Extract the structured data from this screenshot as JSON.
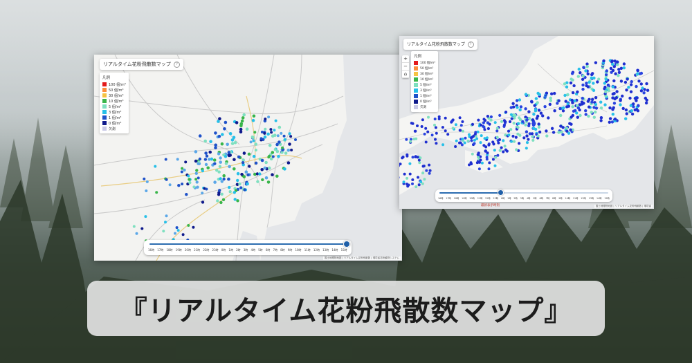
{
  "headline": "『リアルタイム花粉飛散数マップ』",
  "left_shot": {
    "title": "リアルタイム花粉飛散数マップ",
    "help_icon": "?",
    "legend": {
      "header": "凡例",
      "items": [
        {
          "label": "100 個/m³",
          "color": "#e31a1c"
        },
        {
          "label": "50 個/m³",
          "color": "#fd8d3c"
        },
        {
          "label": "30 個/m³",
          "color": "#f6c343"
        },
        {
          "label": "10 個/m³",
          "color": "#39b54a"
        },
        {
          "label": "5 個/m³",
          "color": "#7fe0c0"
        },
        {
          "label": "3 個/m³",
          "color": "#27c0e8"
        },
        {
          "label": "1 個/m³",
          "color": "#1f52c9"
        },
        {
          "label": "0 個/m³",
          "color": "#0f1a8c"
        },
        {
          "label": "欠測",
          "color": "#c9c9e6"
        }
      ]
    },
    "time_ticks": [
      "16時",
      "17時",
      "18時",
      "19時",
      "20時",
      "21時",
      "22時",
      "23時",
      "0時",
      "1時",
      "2時",
      "3時",
      "4時",
      "5時",
      "6時",
      "7時",
      "8時",
      "9時",
      "10時",
      "11時",
      "12時",
      "13時",
      "14時",
      "15時"
    ],
    "slider_value": 1.0,
    "attribution": "国土地理院地図 | リアルタイム花粉飛散数 | 環境省花粉観測システム"
  },
  "right_shot": {
    "title": "リアルタイム花粉飛散数マップ",
    "help_icon": "?",
    "controls": [
      "+",
      "−",
      "⌂"
    ],
    "legend": {
      "header": "凡例",
      "items": [
        {
          "label": "100 個/m³",
          "color": "#e31a1c"
        },
        {
          "label": "50 個/m³",
          "color": "#fd8d3c"
        },
        {
          "label": "30 個/m³",
          "color": "#f6c343"
        },
        {
          "label": "10 個/m³",
          "color": "#39b54a"
        },
        {
          "label": "5 個/m³",
          "color": "#7fe0c0"
        },
        {
          "label": "3 個/m³",
          "color": "#27c0e8"
        },
        {
          "label": "1 個/m³",
          "color": "#1f52c9"
        },
        {
          "label": "0 個/m³",
          "color": "#0f1a8c"
        },
        {
          "label": "欠測",
          "color": "#c9c9e6"
        }
      ]
    },
    "time_ticks": [
      "16時",
      "17時",
      "18時",
      "19時",
      "20時",
      "21時",
      "22時",
      "23時",
      "0時",
      "1時",
      "2時",
      "3時",
      "4時",
      "5時",
      "6時",
      "7時",
      "8時",
      "9時",
      "10時",
      "11時",
      "12時",
      "13時",
      "14時",
      "15時"
    ],
    "slider_value": 0.36,
    "date_label": "最新表示時刻",
    "attribution": "国土地理院地図 | リアルタイム花粉飛散数 | 環境省"
  }
}
